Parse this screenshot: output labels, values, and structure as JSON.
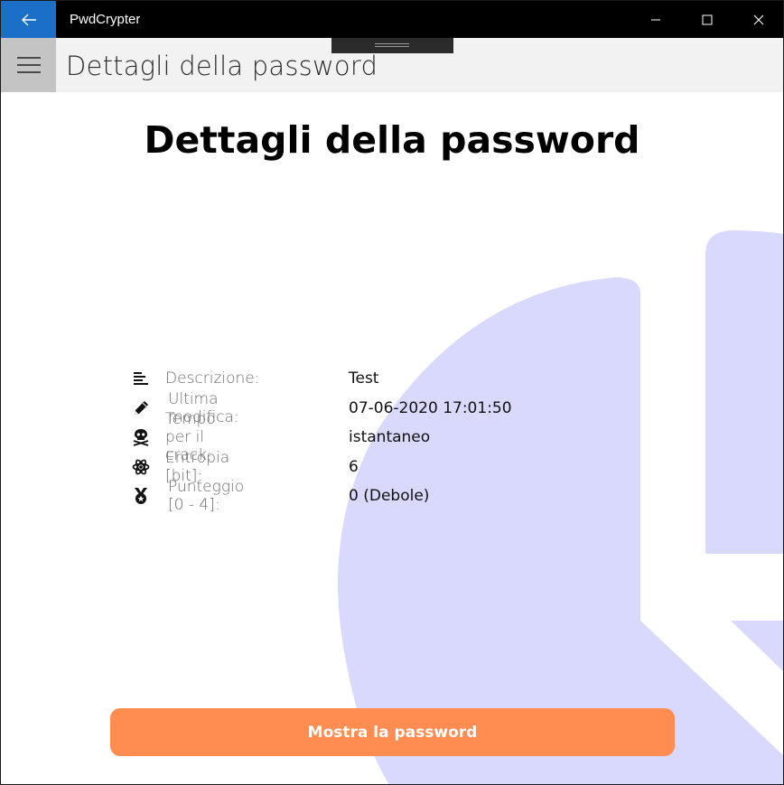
{
  "window": {
    "app_title": "PwdCrypter"
  },
  "header": {
    "title": "Dettagli della password"
  },
  "main": {
    "page_title": "Dettagli della password",
    "details": [
      {
        "icon": "description-lines-icon",
        "label": "Descrizione:",
        "value": "Test"
      },
      {
        "icon": "pencil-icon",
        "label": "Ultima modifica:",
        "value": "07-06-2020 17:01:50"
      },
      {
        "icon": "skull-crossbones-icon",
        "label": "Tempo per il crack:",
        "value": "istantaneo"
      },
      {
        "icon": "atom-icon",
        "label": "Entropia [bit]:",
        "value": "6"
      },
      {
        "icon": "medal-icon",
        "label": "Punteggio [0 - 4]:",
        "value": "0 (Debole)"
      }
    ],
    "show_button_label": "Mostra la password"
  },
  "colors": {
    "accent_blue": "#1c6fc7",
    "button_orange": "#ff8c50",
    "decoration_lavender": "#d9d8fd"
  }
}
